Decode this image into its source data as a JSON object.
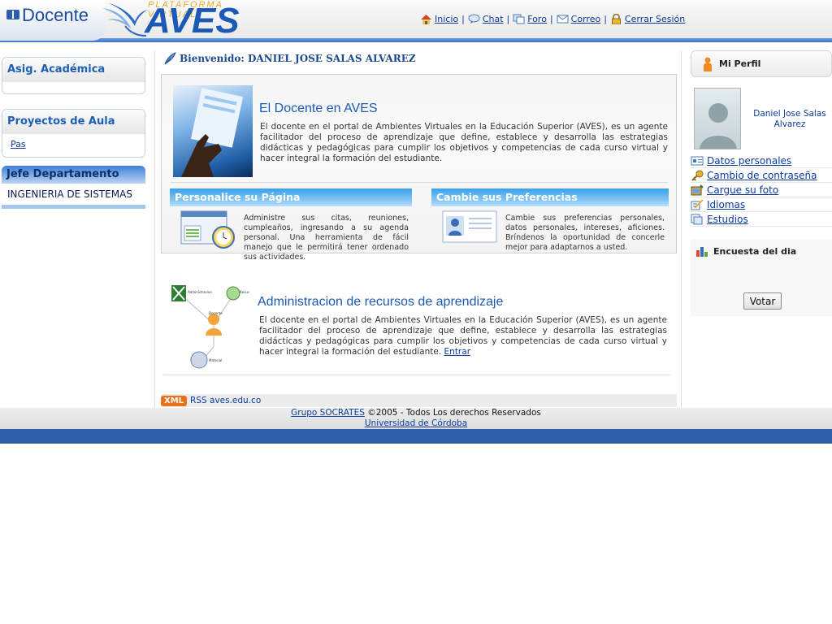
{
  "header": {
    "app_title": "Docente",
    "logo_top": "PLATAFORMA VIRTUAL",
    "logo_big": "AVES",
    "nav": [
      {
        "label": "Inicio",
        "icon": "home-icon"
      },
      {
        "label": "Chat",
        "icon": "chat-icon"
      },
      {
        "label": "Foro",
        "icon": "forum-icon"
      },
      {
        "label": "Correo",
        "icon": "mail-icon"
      },
      {
        "label": "Cerrar Sesión",
        "icon": "lock-icon"
      }
    ]
  },
  "left": {
    "asig_title": "Asig. Académica",
    "proyectos_title": "Proyectos de Aula",
    "proyectos_items": [
      "Pas"
    ],
    "jefe_title": "Jefe Departamento",
    "jefe_value": "INGENIERIA DE SISTEMAS"
  },
  "center": {
    "welcome": "Bienvenido: DANIEL JOSE SALAS ALVAREZ",
    "intro_title": "El Docente en AVES",
    "intro_text": "El docente en el portal de Ambientes Virtuales en la Educación Superior (AVES), es un agente facilitador del proceso de aprendizaje que define, establece y desarrolla las estrategias didácticas y pedagógicas para cumplir los objetivos y competencias de cada curso virtual y hacer integral la formación del estudiante.",
    "personalice_title": "Personalice su Página",
    "personalice_text": "Administre sus citas, reuniones, cumpleaños, ingresando a su agenda personal. Una herramienta de fácil manejo que le permitirá tener ordenado sus actividades.",
    "preferencias_title": "Cambie sus Preferencias",
    "preferencias_text": "Cambie sus preferencias personales, datos personales, intereses, aficiones. Bríndenos la oportunidad de concerle mejor para adaptarnos a usted.",
    "recursos_title": "Administracion de recursos de aprendizaje",
    "recursos_text": "El docente en el portal de Ambientes Virtuales en la Educación Superior (AVES), es un agente facilitador del proceso de aprendizaje que define, establece y desarrolla las estrategias didácticas y pedagógicas para cumplir los objetivos y competencias de cada curso virtual y hacer integral la formación del estudiante.",
    "recursos_link": "Entrar",
    "xml_badge": "XML",
    "rss_text": "RSS aves.edu.co"
  },
  "right": {
    "perfil_title": "Mi Perfil",
    "user_name": "Daniel Jose Salas Alvarez",
    "links": [
      {
        "label": "Datos personales",
        "icon": "id-card-icon"
      },
      {
        "label": "Cambio de contraseña",
        "icon": "key-icon"
      },
      {
        "label": "Cargue su foto",
        "icon": "photo-upload-icon"
      },
      {
        "label": "Idiomas",
        "icon": "language-icon"
      },
      {
        "label": "Estudios",
        "icon": "studies-icon"
      }
    ],
    "encuesta_title": "Encuesta del dia",
    "votar_label": "Votar"
  },
  "footer": {
    "group_link": "Grupo SOCRATES",
    "rights": " ©2005 - Todos Los derechos Reservados",
    "university_link": "Universidad de Córdoba"
  },
  "colors": {
    "brand_blue": "#1c59b6",
    "header_line": "#3d74c8",
    "band_blue": "#3aa0e8",
    "footer_blue": "#2e5ea8",
    "logo_orange": "#e8a92c"
  }
}
